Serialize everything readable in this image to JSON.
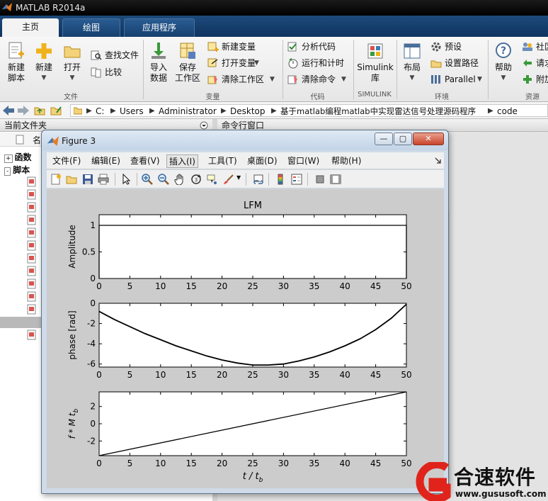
{
  "app": {
    "title": "MATLAB R2014a"
  },
  "tabs": [
    {
      "label": "主页"
    },
    {
      "label": "绘图"
    },
    {
      "label": "应用程序"
    }
  ],
  "ribbon": {
    "file": {
      "new_script": "新建\n脚本",
      "new": "新建",
      "open": "打开",
      "find_files": "查找文件",
      "compare": "比较",
      "group": "文件"
    },
    "variable": {
      "import": "导入\n数据",
      "save_workspace": "保存\n工作区",
      "new_variable": "新建变量",
      "open_variable": "打开变量",
      "clear_workspace": "清除工作区",
      "group": "变量"
    },
    "code": {
      "analyze": "分析代码",
      "run_time": "运行和计时",
      "clear_commands": "清除命令",
      "group": "代码"
    },
    "simulink": {
      "library": "Simulink\n库",
      "group": "SIMULINK"
    },
    "environment": {
      "layout": "布局",
      "preferences": "预设",
      "set_path": "设置路径",
      "parallel": "Parallel",
      "group": "环境"
    },
    "resources": {
      "help": "帮助",
      "community": "社区",
      "request": "请求",
      "addons": "附加",
      "group": "资源"
    }
  },
  "address": {
    "segments": [
      "C:",
      "Users",
      "Administrator",
      "Desktop",
      "基于matlab编程matlab中实现雷达信号处理源码程序",
      "code"
    ]
  },
  "left_panel": {
    "title": "当前文件夹",
    "column": "名",
    "tree": [
      {
        "label": "函数",
        "toggle": "+"
      },
      {
        "label": "脚本",
        "toggle": "-"
      }
    ]
  },
  "command_panel": {
    "title": "命令行窗口"
  },
  "figure": {
    "title": "Figure 3",
    "min": "—",
    "max": "▢",
    "close": "✕",
    "menu": [
      "文件(F)",
      "编辑(E)",
      "查看(V)",
      "插入(I)",
      "工具(T)",
      "桌面(D)",
      "窗口(W)",
      "帮助(H)"
    ],
    "active_menu": "插入(I)"
  },
  "chart_data": [
    {
      "type": "line",
      "title": "LFM",
      "ylabel": "Amplitude",
      "xlabel": "",
      "xlim": [
        0,
        50
      ],
      "ylim": [
        0,
        1.2
      ],
      "xticks": [
        0,
        5,
        10,
        15,
        20,
        25,
        30,
        35,
        40,
        45,
        50
      ],
      "yticks": [
        0,
        0.5,
        1
      ],
      "x": [
        0,
        0,
        50,
        50
      ],
      "y": [
        0,
        1,
        1,
        0
      ]
    },
    {
      "type": "line",
      "title": "",
      "ylabel": "phase [rad]",
      "xlabel": "",
      "xlim": [
        0,
        50
      ],
      "ylim": [
        -6.3,
        0
      ],
      "xticks": [
        0,
        5,
        10,
        15,
        20,
        25,
        30,
        35,
        40,
        45,
        50
      ],
      "yticks": [
        -6,
        -4,
        -2,
        0
      ],
      "x": [
        0,
        2.5,
        5,
        7.5,
        10,
        12.5,
        15,
        17.5,
        20,
        22.5,
        25,
        27.5,
        30,
        32.5,
        35,
        37.5,
        40,
        42.5,
        45,
        47.5,
        50
      ],
      "y": [
        -0.8,
        -1.6,
        -2.3,
        -3.0,
        -3.6,
        -4.2,
        -4.7,
        -5.2,
        -5.6,
        -5.9,
        -6.1,
        -6.1,
        -6.0,
        -5.7,
        -5.3,
        -4.8,
        -4.2,
        -3.5,
        -2.6,
        -1.5,
        -0.1
      ]
    },
    {
      "type": "line",
      "title": "",
      "ylabel": "f * M t_b",
      "xlabel": "t / t_b",
      "xlim": [
        0,
        50
      ],
      "ylim": [
        -3.7,
        3.7
      ],
      "xticks": [
        0,
        5,
        10,
        15,
        20,
        25,
        30,
        35,
        40,
        45,
        50
      ],
      "yticks": [
        -2,
        0,
        2
      ],
      "x": [
        0,
        50
      ],
      "y": [
        -3.7,
        3.7
      ]
    }
  ],
  "watermark": {
    "brand": "合速软件",
    "url": "www.gususoft.com"
  },
  "colors": {
    "ribbon_tab": "#0f3360",
    "figure_frame": "#cfdbe8",
    "plot_bg": "#cccccc",
    "line": "#000000",
    "watermark_red": "#e0241b"
  }
}
